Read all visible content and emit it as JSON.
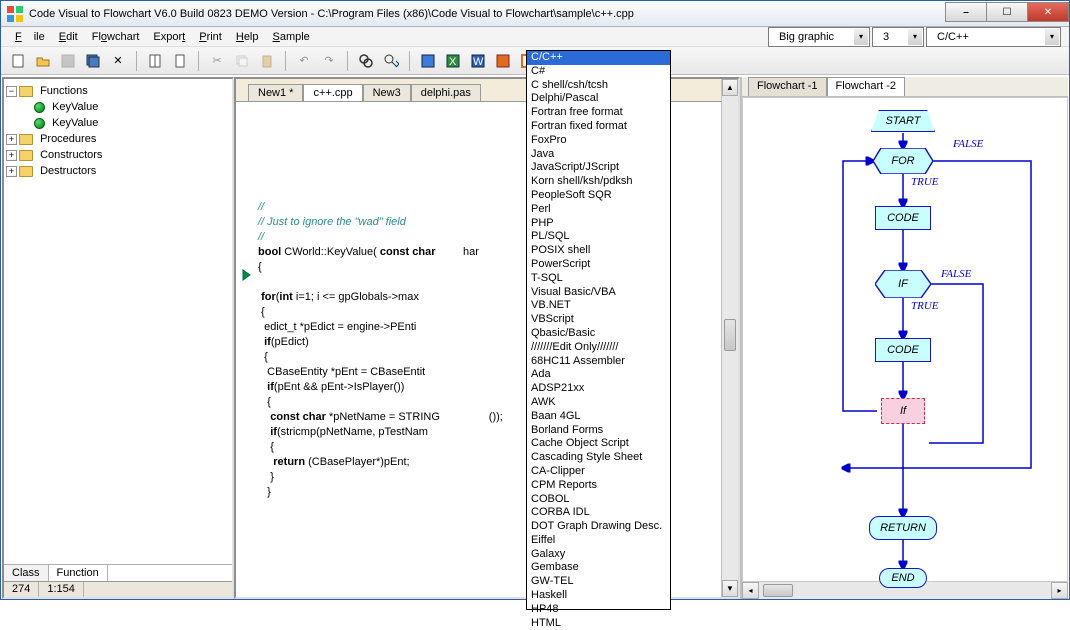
{
  "window": {
    "title": "Code Visual to Flowchart V6.0 Build 0823 DEMO Version - C:\\Program Files (x86)\\Code Visual to Flowchart\\sample\\c++.cpp"
  },
  "menu": {
    "file": "File",
    "edit": "Edit",
    "flowchart": "Flowchart",
    "export": "Export",
    "print": "Print",
    "help": "Help",
    "sample": "Sample"
  },
  "selectors": {
    "graphic": "Big graphic",
    "num": "3",
    "lang": "C/C++"
  },
  "tree": {
    "functions": "Functions",
    "keyvalue1": "KeyValue",
    "keyvalue2": "KeyValue",
    "procedures": "Procedures",
    "constructors": "Constructors",
    "destructors": "Destructors"
  },
  "bottom_tabs": {
    "class": "Class",
    "function": "Function"
  },
  "file_tabs": {
    "new1": "New1 *",
    "cpp": "c++.cpp",
    "new3": "New3",
    "delphi": "delphi.pas"
  },
  "code_lines": [
    "//",
    "// Just to ignore the \"wad\" field",
    "//",
    "bool CWorld::KeyValue( const char         har",
    "{",
    "",
    " for(int i=1; i <= gpGlobals->max",
    " {",
    "  edict_t *pEdict = engine->PEnti",
    "  if(pEdict)",
    "  {",
    "   CBaseEntity *pEnt = CBaseEntit",
    "   if(pEnt && pEnt->IsPlayer())",
    "   {",
    "    const char *pNetName = STRING                ());",
    "    if(stricmp(pNetName, pTestNam",
    "    {",
    "     return (CBasePlayer*)pEnt;",
    "    }",
    "   }"
  ],
  "status": {
    "line": "274",
    "col": "1:154"
  },
  "dropdown": [
    "C/C++",
    "C#",
    "C shell/csh/tcsh",
    "Delphi/Pascal",
    "Fortran free format",
    "Fortran fixed format",
    "FoxPro",
    "Java",
    "JavaScript/JScript",
    "Korn shell/ksh/pdksh",
    "PeopleSoft SQR",
    "Perl",
    "PHP",
    "PL/SQL",
    "POSIX shell",
    "PowerScript",
    "T-SQL",
    "Visual Basic/VBA",
    "VB.NET",
    "VBScript",
    "Qbasic/Basic",
    "///////Edit Only///////",
    "68HC11 Assembler",
    "Ada",
    "ADSP21xx",
    "AWK",
    "Baan 4GL",
    "Borland Forms",
    "Cache Object Script",
    "Cascading Style Sheet",
    "CA-Clipper",
    "CPM Reports",
    "COBOL",
    "CORBA IDL",
    "DOT Graph Drawing Desc.",
    "Eiffel",
    "Galaxy",
    "Gembase",
    "GW-TEL",
    "Haskell",
    "HP48",
    "HTML"
  ],
  "right_tabs": {
    "fc1": "Flowchart -1",
    "fc2": "Flowchart -2"
  },
  "flow": {
    "start": "START",
    "for": "FOR",
    "code1": "CODE",
    "if1": "IF",
    "code2": "CODE",
    "if2": "If",
    "return": "RETURN",
    "end": "END",
    "true1": "TRUE",
    "false1": "FALSE",
    "true2": "TRUE",
    "false2": "FALSE"
  }
}
